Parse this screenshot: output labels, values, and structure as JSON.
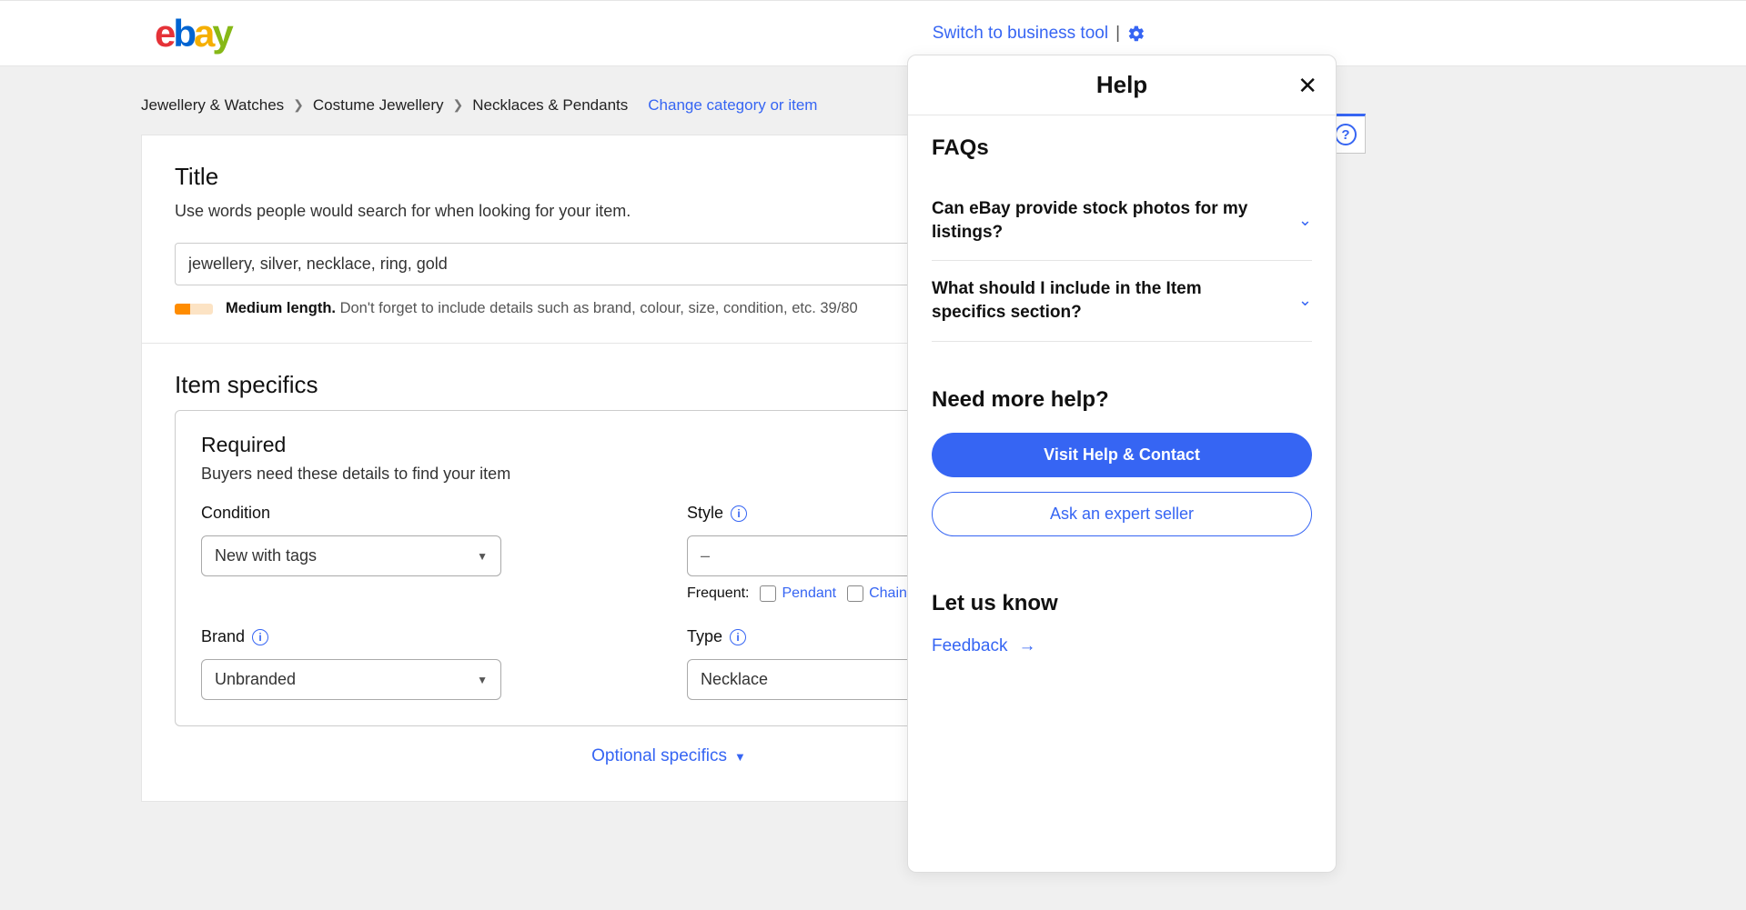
{
  "header": {
    "switch_link": "Switch to business tool"
  },
  "breadcrumb": {
    "items": [
      "Jewellery & Watches",
      "Costume Jewellery",
      "Necklaces & Pendants"
    ],
    "change_link": "Change category or item"
  },
  "title_section": {
    "heading": "Title",
    "desc": "Use words people would search for when looking for your item.",
    "value": "jewellery, silver, necklace, ring, gold",
    "strength_label": "Medium length.",
    "strength_hint": "Don't forget to include details such as brand, colour, size, condition, etc. 39/80"
  },
  "specifics": {
    "heading": "Item specifics",
    "required_heading": "Required",
    "required_desc": "Buyers need these details to find your item",
    "fields": {
      "condition": {
        "label": "Condition",
        "value": "New with tags"
      },
      "style": {
        "label": "Style",
        "value": "–",
        "frequent_label": "Frequent:",
        "options": [
          "Pendant",
          "Chain",
          "Cha"
        ]
      },
      "brand": {
        "label": "Brand",
        "value": "Unbranded"
      },
      "type": {
        "label": "Type",
        "value": "Necklace"
      }
    },
    "optional_link": "Optional specifics"
  },
  "help_panel": {
    "title": "Help",
    "faqs_heading": "FAQs",
    "faqs": [
      "Can eBay provide stock photos for my listings?",
      "What should I include in the Item specifics section?"
    ],
    "need_more": "Need more help?",
    "visit_btn": "Visit Help & Contact",
    "ask_btn": "Ask an expert seller",
    "let_us_know": "Let us know",
    "feedback": "Feedback"
  }
}
